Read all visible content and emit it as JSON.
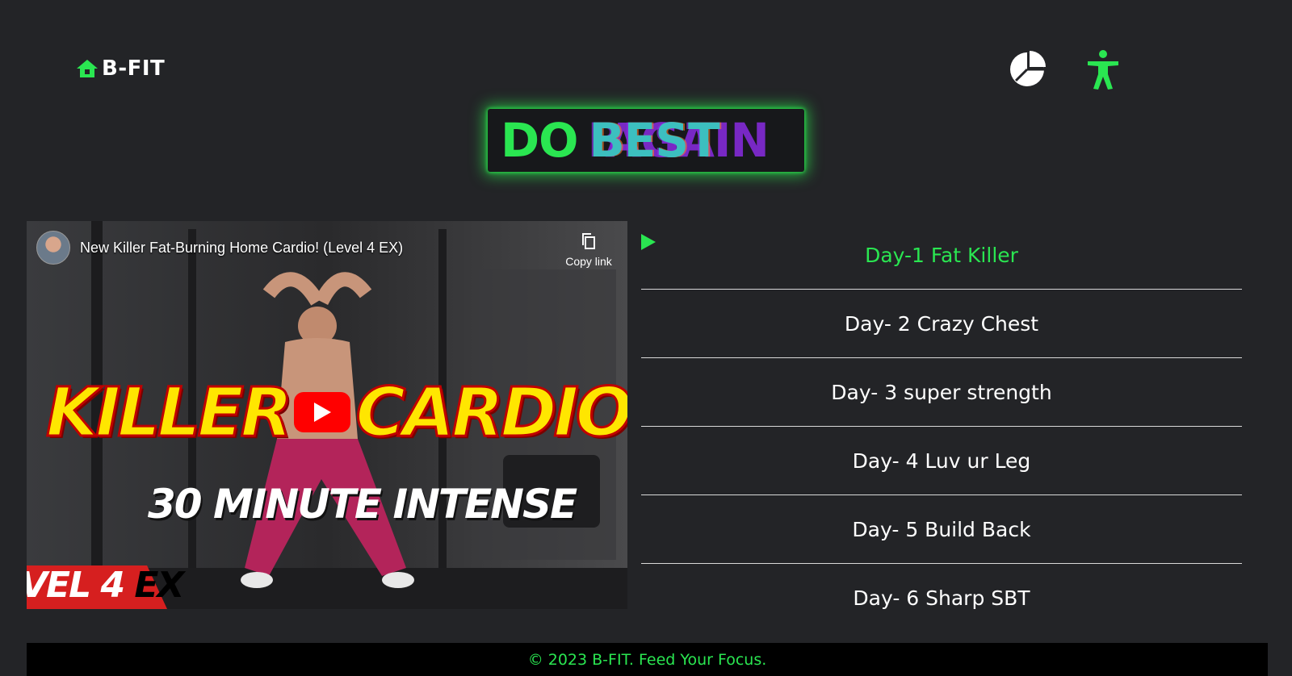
{
  "brand": {
    "name": "B-FIT",
    "icon": "home-icon"
  },
  "header_icons": [
    {
      "name": "pie-chart-icon"
    },
    {
      "name": "accessibility-icon"
    }
  ],
  "hero": {
    "word1": "DO",
    "word2_front": "BEST",
    "word2_ghost": "AGAIN"
  },
  "video": {
    "title": "New Killer Fat-Burning Home Cardio! (Level 4 EX)",
    "copy_link": "Copy link",
    "thumbnail": {
      "left_word": "KILLER",
      "right_word": "CARDIO",
      "subtitle": "30 MINUTE INTENSE",
      "level": "VEL 4",
      "level_suffix": "EX"
    }
  },
  "days": [
    {
      "label": "Day-1 Fat Killer",
      "active": true
    },
    {
      "label": "Day- 2 Crazy Chest",
      "active": false
    },
    {
      "label": "Day- 3 super strength",
      "active": false
    },
    {
      "label": "Day- 4 Luv ur Leg",
      "active": false
    },
    {
      "label": "Day- 5 Build Back",
      "active": false
    },
    {
      "label": "Day- 6 Sharp SBT",
      "active": false
    }
  ],
  "footer": {
    "text": "© 2023 B-FIT. Feed Your Focus."
  },
  "colors": {
    "accent": "#2ae651",
    "background": "#232427",
    "footer_bg": "#000000",
    "youtube_red": "#ff0000"
  }
}
